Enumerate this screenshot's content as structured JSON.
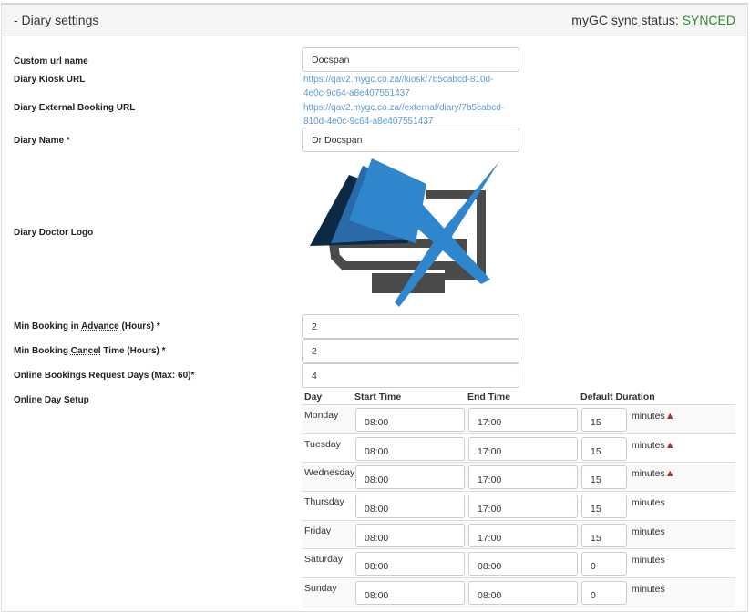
{
  "header": {
    "title": "- Diary settings",
    "sync_label": "myGC sync status: ",
    "sync_value": "SYNCED",
    "sync_color": "#2e8b2e"
  },
  "fields": {
    "custom_url_label": "Custom url name",
    "custom_url_value": "Docspan",
    "kiosk_label": "Diary Kiosk URL",
    "kiosk_url": "https://qav2.mygc.co.za//kiosk/7b5cabcd-810d-4e0c-9c64-a8e407551437",
    "external_label": "Diary External Booking URL",
    "external_url": "https://qav2.mygc.co.za//external/diary/7b5cabcd-810d-4e0c-9c64-a8e407551437",
    "name_label": "Diary Name *",
    "name_value": "Dr Docspan",
    "logo_label": "Diary Doctor Logo",
    "min_advance_label_a": "Min Booking in ",
    "min_advance_label_b": "Advance",
    "min_advance_label_c": " (Hours) *",
    "min_advance_value": "2",
    "min_cancel_label_a": "Min Booking ",
    "min_cancel_label_b": "Cancel",
    "min_cancel_label_c": " Time (Hours) *",
    "min_cancel_value": "2",
    "request_days_label": "Online Bookings Request Days (Max: 60)*",
    "request_days_value": "4",
    "day_setup_label": "Online Day Setup"
  },
  "table": {
    "headers": [
      "Day",
      "Start Time",
      "End Time",
      "Default Duration"
    ],
    "unit": "minutes",
    "rows": [
      {
        "day": "Monday",
        "start": "08:00",
        "end": "17:00",
        "duration": "15",
        "warn": true
      },
      {
        "day": "Tuesday",
        "start": "08:00",
        "end": "17:00",
        "duration": "15",
        "warn": true
      },
      {
        "day": "Wednesday",
        "start": "08:00",
        "end": "17:00",
        "duration": "15",
        "warn": true
      },
      {
        "day": "Thursday",
        "start": "08:00",
        "end": "17:00",
        "duration": "15",
        "warn": false
      },
      {
        "day": "Friday",
        "start": "08:00",
        "end": "17:00",
        "duration": "15",
        "warn": false
      },
      {
        "day": "Saturday",
        "start": "08:00",
        "end": "08:00",
        "duration": "0",
        "warn": false
      },
      {
        "day": "Sunday",
        "start": "08:00",
        "end": "08:00",
        "duration": "0",
        "warn": false
      }
    ]
  }
}
